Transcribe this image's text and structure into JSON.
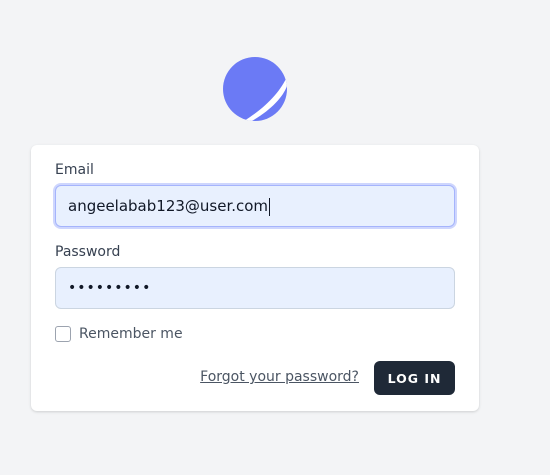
{
  "brand": {
    "logo_icon": "planet-icon",
    "logo_color": "#6b7af5"
  },
  "form": {
    "email_label": "Email",
    "email_value": "angeelabab123@user.com",
    "password_label": "Password",
    "password_value": "•••••••••",
    "remember_label": "Remember me",
    "remember_checked": false,
    "forgot_link": "Forgot your password?",
    "login_button": "LOG IN"
  },
  "colors": {
    "background": "#f3f4f6",
    "input_fill": "#e8f0fe",
    "button": "#1f2937"
  }
}
